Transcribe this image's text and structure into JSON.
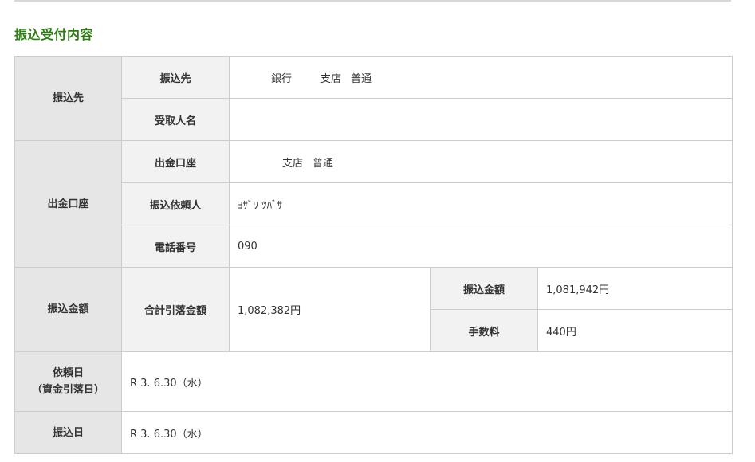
{
  "page": {
    "section_title": "振込受付内容"
  },
  "payee": {
    "category": "振込先",
    "dest_label": "振込先",
    "bank": "銀行",
    "branch": "支店",
    "account_type": "普通",
    "recipient_label": "受取人名",
    "recipient_value": ""
  },
  "withdrawal": {
    "category": "出金口座",
    "account_label": "出金口座",
    "branch": "支店",
    "account_type": "普通",
    "requester_label": "振込依頼人",
    "requester_value": "ﾖｻﾞﾜ ﾂﾊﾞｻ",
    "phone_label": "電話番号",
    "phone_value": "090"
  },
  "amount": {
    "category": "振込金額",
    "total_label": "合計引落金額",
    "total_value": "1,082,382円",
    "transfer_label": "振込金額",
    "transfer_value": "1,081,942円",
    "fee_label": "手数料",
    "fee_value": "440円"
  },
  "request_date": {
    "label_line1": "依頼日",
    "label_line2": "（資金引落日）",
    "value": "R 3. 6.30（水）"
  },
  "transfer_date": {
    "label": "振込日",
    "value": "R 3. 6.30（水）"
  }
}
